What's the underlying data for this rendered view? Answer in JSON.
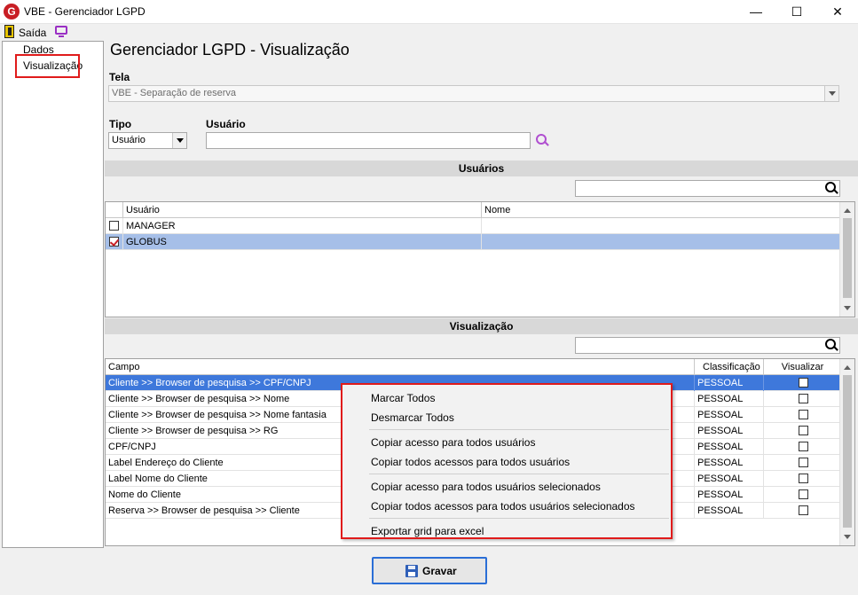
{
  "window": {
    "title": "VBE - Gerenciador LGPD",
    "app_icon_letter": "G",
    "controls": {
      "minimize": "—",
      "maximize": "☐",
      "close": "✕"
    }
  },
  "toolbar": {
    "exit_label": "Saída"
  },
  "tree": {
    "items": [
      "Dados",
      "Visualização"
    ],
    "selected": "Visualização"
  },
  "page": {
    "title": "Gerenciador LGPD - Visualização"
  },
  "form": {
    "tela_label": "Tela",
    "tela_value": "VBE - Separação de reserva",
    "tipo_label": "Tipo",
    "tipo_value": "Usuário",
    "usuario_label": "Usuário",
    "usuario_value": ""
  },
  "usuarios_section": {
    "title": "Usuários",
    "search_value": "",
    "columns": [
      "Usuário",
      "Nome"
    ],
    "rows": [
      {
        "usuario": "MANAGER",
        "nome": "",
        "checked": false
      },
      {
        "usuario": "GLOBUS",
        "nome": "",
        "checked": true
      }
    ]
  },
  "visualizacao_section": {
    "title": "Visualização",
    "search_value": "",
    "columns": [
      "Campo",
      "Classificação",
      "Visualizar"
    ],
    "rows": [
      {
        "campo": "Cliente >> Browser de pesquisa >> CPF/CNPJ",
        "classificacao": "PESSOAL",
        "visualizar": false
      },
      {
        "campo": "Cliente >> Browser de pesquisa >> Nome",
        "classificacao": "PESSOAL",
        "visualizar": false
      },
      {
        "campo": "Cliente >> Browser de pesquisa >> Nome fantasia",
        "classificacao": "PESSOAL",
        "visualizar": false
      },
      {
        "campo": "Cliente >> Browser de pesquisa >> RG",
        "classificacao": "PESSOAL",
        "visualizar": false
      },
      {
        "campo": "CPF/CNPJ",
        "classificacao": "PESSOAL",
        "visualizar": false
      },
      {
        "campo": "Label Endereço do Cliente",
        "classificacao": "PESSOAL",
        "visualizar": false
      },
      {
        "campo": "Label Nome do Cliente",
        "classificacao": "PESSOAL",
        "visualizar": false
      },
      {
        "campo": "Nome do Cliente",
        "classificacao": "PESSOAL",
        "visualizar": false
      },
      {
        "campo": "Reserva >> Browser de pesquisa >> Cliente",
        "classificacao": "PESSOAL",
        "visualizar": false
      }
    ]
  },
  "context_menu": {
    "items": [
      "Marcar Todos",
      "Desmarcar Todos",
      "Copiar acesso para todos usuários",
      "Copiar todos acessos para todos usuários",
      "Copiar acesso para todos usuários selecionados",
      "Copiar todos acessos para todos usuários selecionados",
      "Exportar grid para excel"
    ]
  },
  "actions": {
    "save_label": "Gravar"
  },
  "colors": {
    "accent_red": "#e01b1b",
    "selection_blue": "#3e78db",
    "selection_light": "#a6bfe8",
    "brand_red": "#c81e24",
    "icon_purple": "#9a2fc4"
  }
}
